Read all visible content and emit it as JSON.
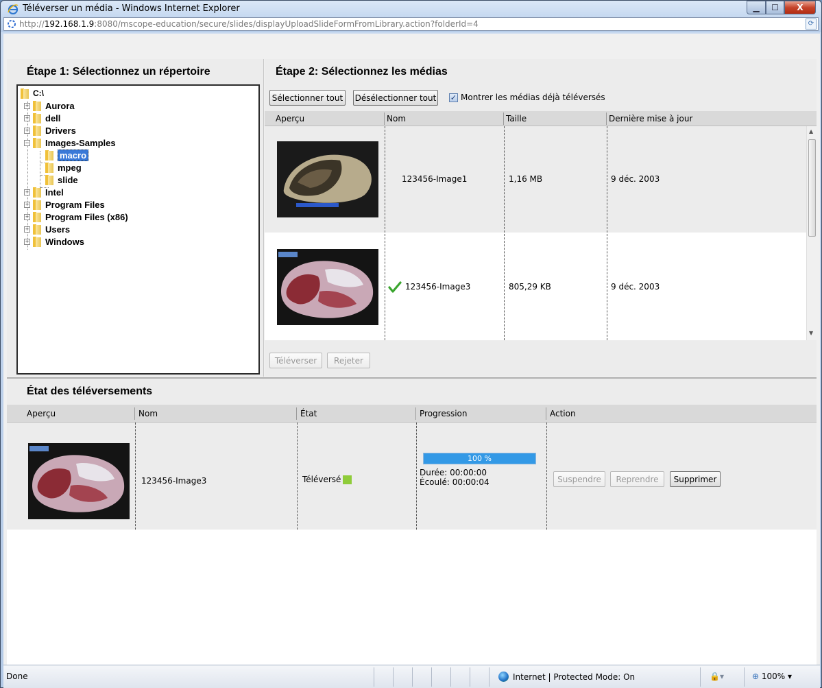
{
  "window": {
    "title": "Téléverser un média - Windows Internet Explorer",
    "url_prefix": "http://",
    "url_host": "192.168.1.9",
    "url_rest": ":8080/mscope-education/secure/slides/displayUploadSlideFormFromLibrary.action?folderId=4",
    "min_label": "▁",
    "max_label": "☐",
    "close_label": "X"
  },
  "step1": {
    "title": "Étape 1: Sélectionnez un répertoire",
    "root": "C:\\",
    "folders": [
      {
        "label": "Aurora"
      },
      {
        "label": "dell"
      },
      {
        "label": "Drivers"
      },
      {
        "label": "Images-Samples"
      },
      {
        "label": "macro"
      },
      {
        "label": "mpeg"
      },
      {
        "label": "slide"
      },
      {
        "label": "Intel"
      },
      {
        "label": "Program Files"
      },
      {
        "label": "Program Files (x86)"
      },
      {
        "label": "Users"
      },
      {
        "label": "Windows"
      }
    ],
    "selected": "macro"
  },
  "step2": {
    "title": "Étape 2: Sélectionnez les médias",
    "select_all": "Sélectionner tout",
    "deselect_all": "Désélectionner tout",
    "show_uploaded_label": "Montrer les médias déjà téléversés",
    "show_uploaded_checked": true,
    "columns": [
      "Aperçu",
      "Nom",
      "Taille",
      "Dernière mise à jour"
    ],
    "rows": [
      {
        "name": "123456-Image1",
        "size": "1,16 MB",
        "date": "9 déc. 2003",
        "uploaded": false
      },
      {
        "name": "123456-Image3",
        "size": "805,29 KB",
        "date": "9 déc. 2003",
        "uploaded": true
      }
    ],
    "upload_button": "Téléverser",
    "reject_button": "Rejeter"
  },
  "uploads": {
    "title": "État des téléversements",
    "columns": [
      "Aperçu",
      "Nom",
      "État",
      "Progression",
      "Action"
    ],
    "rows": [
      {
        "name": "123456-Image3",
        "state": "Téléversé",
        "progress_label": "100 %",
        "progress": 1.0,
        "duration": "Durée: 00:00:00",
        "elapsed": "Écoulé: 00:00:04",
        "suspend": "Suspendre",
        "resume": "Reprendre",
        "delete": "Supprimer"
      }
    ]
  },
  "statusbar": {
    "left": "Done",
    "zone": "Internet | Protected Mode: On",
    "zoom": "100%"
  },
  "colors": {
    "selection": "#3a79d8",
    "progress": "#3399e6",
    "uploaded_badge": "#8fcc3a",
    "check": "#3aa52e"
  }
}
